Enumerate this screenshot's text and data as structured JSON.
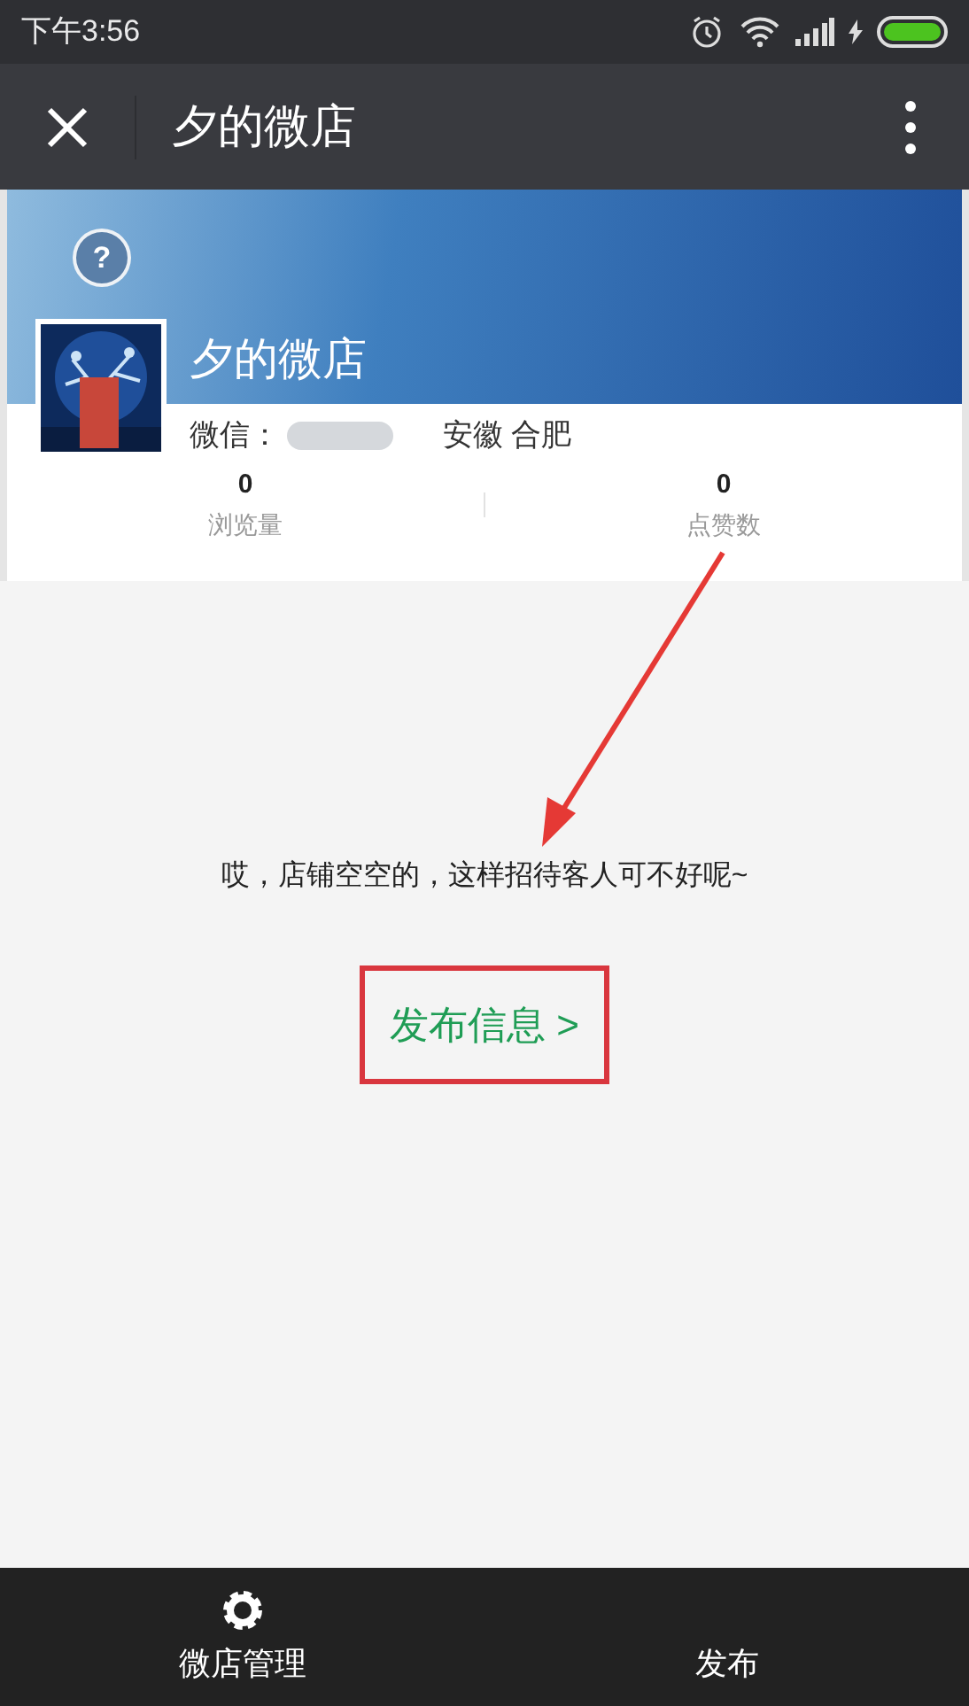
{
  "status_bar": {
    "time": "下午3:56"
  },
  "header": {
    "title": "夕的微店"
  },
  "shop": {
    "help": "?",
    "name": "夕的微店",
    "wechat_label": "微信：",
    "location": "安徽 合肥"
  },
  "stats": [
    {
      "value": "0",
      "label": "浏览量"
    },
    {
      "value": "0",
      "label": "点赞数"
    }
  ],
  "empty_state": {
    "message": "哎，店铺空空的，这样招待客人可不好呢~",
    "action": "发布信息 >"
  },
  "bottom_bar": [
    {
      "kind": "settings",
      "label": "微店管理"
    },
    {
      "kind": "publish",
      "label": "发布"
    }
  ]
}
